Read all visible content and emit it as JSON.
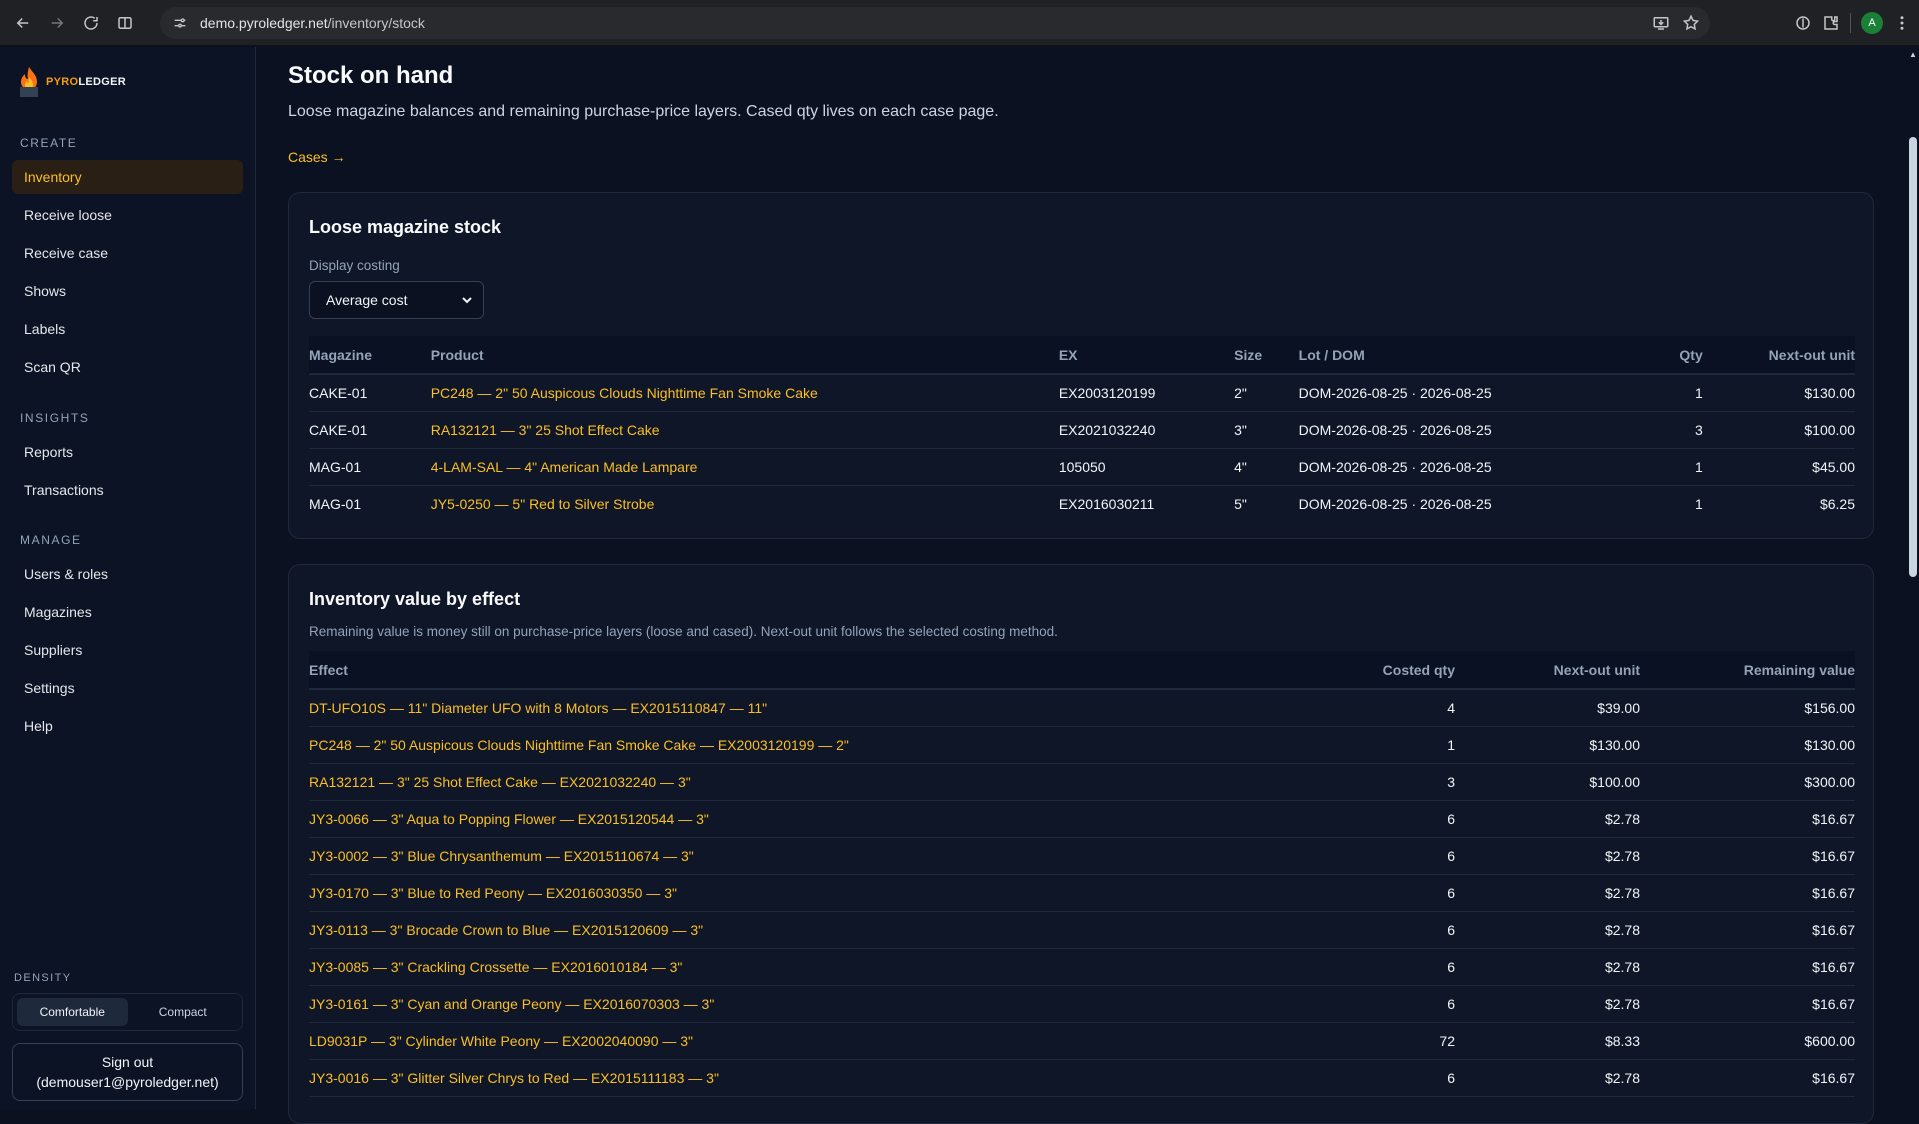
{
  "browser": {
    "url_host": "demo.pyroledger.net",
    "url_path": "/inventory/stock",
    "profile_initial": "A"
  },
  "sidebar": {
    "logo_text_a": "PYRO",
    "logo_text_b": "LEDGER",
    "sections": {
      "create": "CREATE",
      "insights": "INSIGHTS",
      "manage": "MANAGE"
    },
    "items": [
      {
        "label": "Inventory",
        "active": true
      },
      {
        "label": "Receive loose"
      },
      {
        "label": "Receive case"
      },
      {
        "label": "Shows"
      },
      {
        "label": "Labels"
      },
      {
        "label": "Scan QR"
      },
      {
        "label": "Reports"
      },
      {
        "label": "Transactions"
      },
      {
        "label": "Users & roles"
      },
      {
        "label": "Magazines"
      },
      {
        "label": "Suppliers"
      },
      {
        "label": "Settings"
      },
      {
        "label": "Help"
      }
    ],
    "density_label": "DENSITY",
    "density_options": [
      "Comfortable",
      "Compact"
    ],
    "signout_line1": "Sign out",
    "signout_line2": "(demouser1@pyroledger.net)"
  },
  "page": {
    "title": "Stock on hand",
    "subtitle": "Loose magazine balances and remaining purchase-price layers. Cased qty lives on each case page.",
    "cases_link": "Cases →"
  },
  "loose": {
    "title": "Loose magazine stock",
    "costing_label": "Display costing",
    "costing_value": "Average cost",
    "headers": [
      "Magazine",
      "Product",
      "EX",
      "Size",
      "Lot / DOM",
      "Qty",
      "Next-out unit"
    ],
    "rows": [
      [
        "CAKE-01",
        "PC248 — 2\" 50 Auspicous Clouds Nighttime Fan Smoke Cake",
        "EX2003120199",
        "2\"",
        "DOM-2026-08-25 · 2026-08-25",
        "1",
        "$130.00"
      ],
      [
        "CAKE-01",
        "RA132121 — 3\" 25 Shot Effect Cake",
        "EX2021032240",
        "3\"",
        "DOM-2026-08-25 · 2026-08-25",
        "3",
        "$100.00"
      ],
      [
        "MAG-01",
        "4-LAM-SAL — 4\" American Made Lampare",
        "105050",
        "4\"",
        "DOM-2026-08-25 · 2026-08-25",
        "1",
        "$45.00"
      ],
      [
        "MAG-01",
        "JY5-0250 — 5\" Red to Silver Strobe",
        "EX2016030211",
        "5\"",
        "DOM-2026-08-25 · 2026-08-25",
        "1",
        "$6.25"
      ]
    ]
  },
  "value": {
    "title": "Inventory value by effect",
    "desc": "Remaining value is money still on purchase-price layers (loose and cased). Next-out unit follows the selected costing method.",
    "headers": [
      "Effect",
      "Costed qty",
      "Next-out unit",
      "Remaining value"
    ],
    "rows": [
      [
        "DT-UFO10S — 11\" Diameter UFO with 8 Motors — EX2015110847 — 11\"",
        "4",
        "$39.00",
        "$156.00"
      ],
      [
        "PC248 — 2\" 50 Auspicous Clouds Nighttime Fan Smoke Cake — EX2003120199 — 2\"",
        "1",
        "$130.00",
        "$130.00"
      ],
      [
        "RA132121 — 3\" 25 Shot Effect Cake — EX2021032240 — 3\"",
        "3",
        "$100.00",
        "$300.00"
      ],
      [
        "JY3-0066 — 3\" Aqua to Popping Flower — EX2015120544 — 3\"",
        "6",
        "$2.78",
        "$16.67"
      ],
      [
        "JY3-0002 — 3\" Blue Chrysanthemum — EX2015110674 — 3\"",
        "6",
        "$2.78",
        "$16.67"
      ],
      [
        "JY3-0170 — 3\" Blue to Red Peony — EX2016030350 — 3\"",
        "6",
        "$2.78",
        "$16.67"
      ],
      [
        "JY3-0113 — 3\" Brocade Crown to Blue — EX2015120609 — 3\"",
        "6",
        "$2.78",
        "$16.67"
      ],
      [
        "JY3-0085 — 3\" Crackling Crossette — EX2016010184 — 3\"",
        "6",
        "$2.78",
        "$16.67"
      ],
      [
        "JY3-0161 — 3\" Cyan and Orange Peony — EX2016070303 — 3\"",
        "6",
        "$2.78",
        "$16.67"
      ],
      [
        "LD9031P — 3\" Cylinder White Peony — EX2002040090 — 3\"",
        "72",
        "$8.33",
        "$600.00"
      ],
      [
        "JY3-0016 — 3\" Glitter Silver Chrys to Red — EX2015111183 — 3\"",
        "6",
        "$2.78",
        "$16.67"
      ]
    ]
  }
}
